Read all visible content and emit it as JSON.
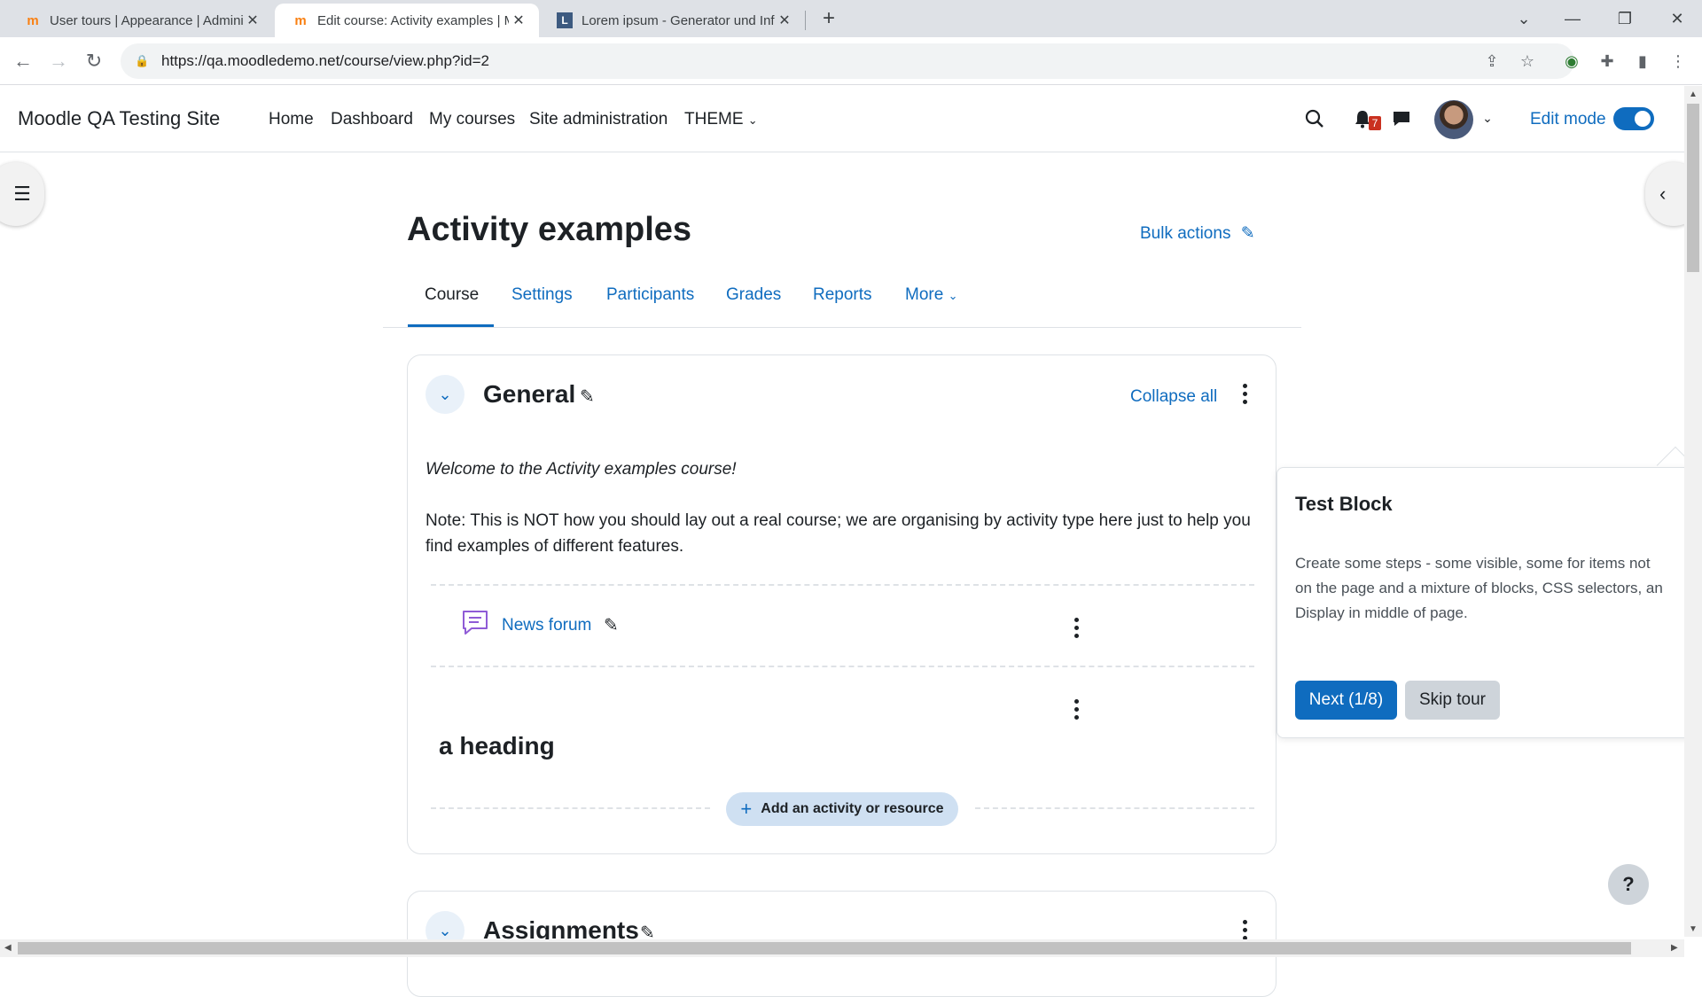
{
  "browser": {
    "tabs": [
      {
        "title": "User tours | Appearance | Admini",
        "active": false
      },
      {
        "title": "Edit course: Activity examples | M",
        "active": true
      },
      {
        "title": "Lorem ipsum - Generator und Inf",
        "active": false
      }
    ],
    "url": "https://qa.moodledemo.net/course/view.php?id=2"
  },
  "navbar": {
    "site_name": "Moodle QA Testing Site",
    "links": [
      "Home",
      "Dashboard",
      "My courses",
      "Site administration",
      "THEME"
    ],
    "notification_count": "7",
    "edit_mode_label": "Edit mode",
    "edit_mode_on": true
  },
  "page": {
    "title": "Activity examples",
    "bulk_actions": "Bulk actions",
    "tabs": [
      "Course",
      "Settings",
      "Participants",
      "Grades",
      "Reports",
      "More"
    ],
    "active_tab": "Course"
  },
  "section_general": {
    "title": "General",
    "collapse_all": "Collapse all",
    "summary_welcome": "Welcome to the Activity examples course!",
    "summary_note": "Note: This is NOT how you should lay out a real course; we are organising by activity type here just to help you find examples of different features.",
    "forum_link": "News forum",
    "heading": "a heading",
    "add_activity": "Add an activity or resource"
  },
  "section_assignments": {
    "title": "Assignments"
  },
  "tour": {
    "title": "Test Block",
    "content": "Create some steps - some visible, some for items not\non the page and a mixture of blocks, CSS selectors, an\nDisplay in middle of page.",
    "next_label": "Next (1/8)",
    "skip_label": "Skip tour"
  },
  "help_label": "?",
  "colors": {
    "primary": "#0f6cbf",
    "badge": "#ca3120",
    "tab_strip": "#dee1e6"
  }
}
